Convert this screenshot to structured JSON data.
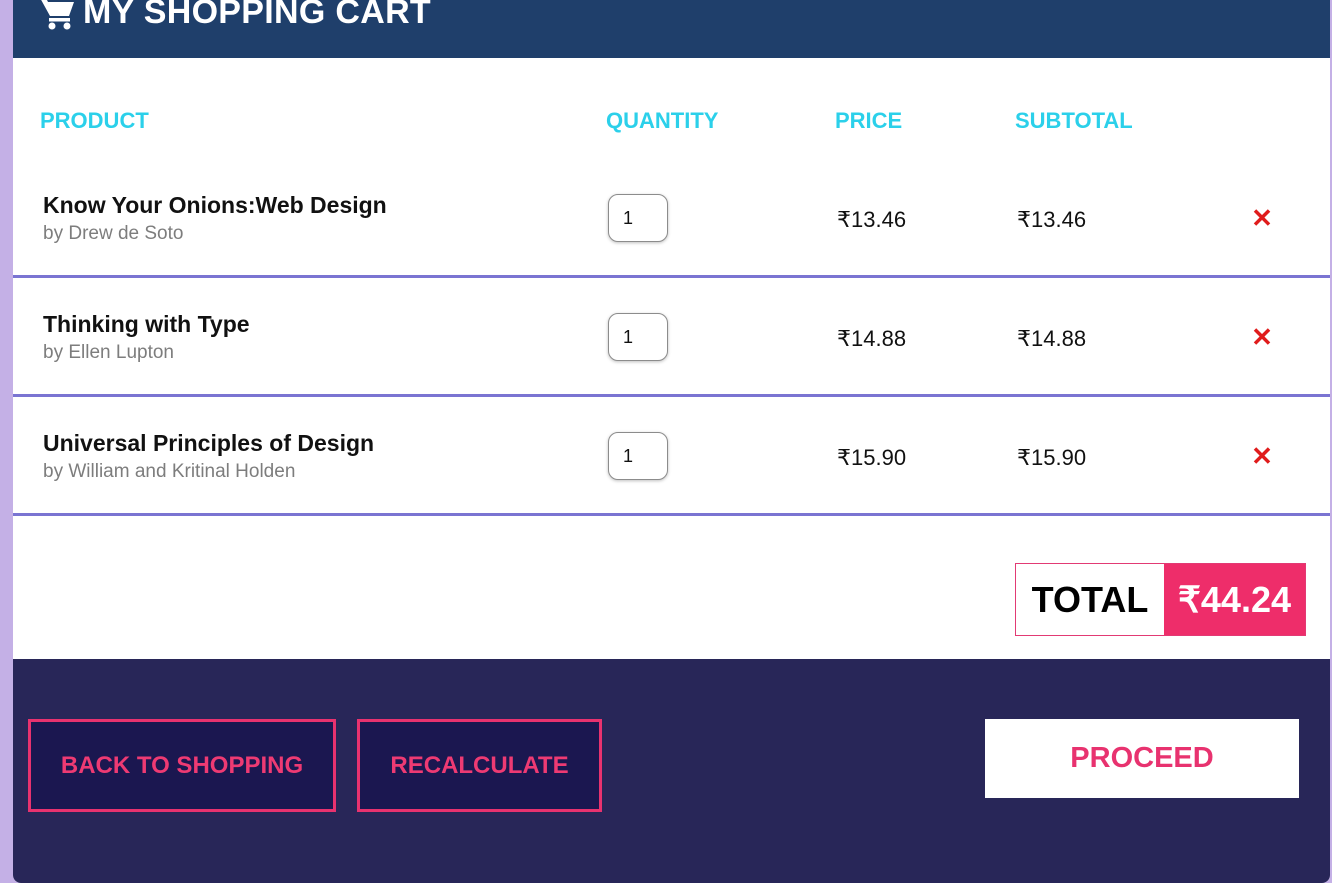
{
  "header": {
    "title": "MY SHOPPING CART",
    "icon": "shopping-cart-icon"
  },
  "columns": {
    "product": "PRODUCT",
    "quantity": "QUANTITY",
    "price": "PRICE",
    "subtotal": "SUBTOTAL"
  },
  "items": [
    {
      "name": "Know Your Onions:Web Design",
      "author": "by Drew de Soto",
      "quantity": "1",
      "price": "₹13.46",
      "subtotal": "₹13.46",
      "remove": "✕"
    },
    {
      "name": "Thinking with Type",
      "author": "by Ellen Lupton",
      "quantity": "1",
      "price": "₹14.88",
      "subtotal": "₹14.88",
      "remove": "✕"
    },
    {
      "name": "Universal Principles of Design",
      "author": "by William and Kritinal Holden",
      "quantity": "1",
      "price": "₹15.90",
      "subtotal": "₹15.90",
      "remove": "✕"
    }
  ],
  "total": {
    "label": "TOTAL",
    "value": "₹44.24"
  },
  "footer": {
    "back_label": "BACK TO SHOPPING",
    "recalc_label": "RECALCULATE",
    "proceed_label": "PROCEED"
  },
  "colors": {
    "header_bg": "#1f3f6b",
    "column_heading": "#2bd0ea",
    "row_divider": "#7a74d2",
    "accent_pink": "#ee2d6a",
    "footer_bg": "#282658",
    "button_bg": "#1b1750",
    "remove_red": "#e01c1c",
    "page_bg": "#c4b0e6"
  }
}
